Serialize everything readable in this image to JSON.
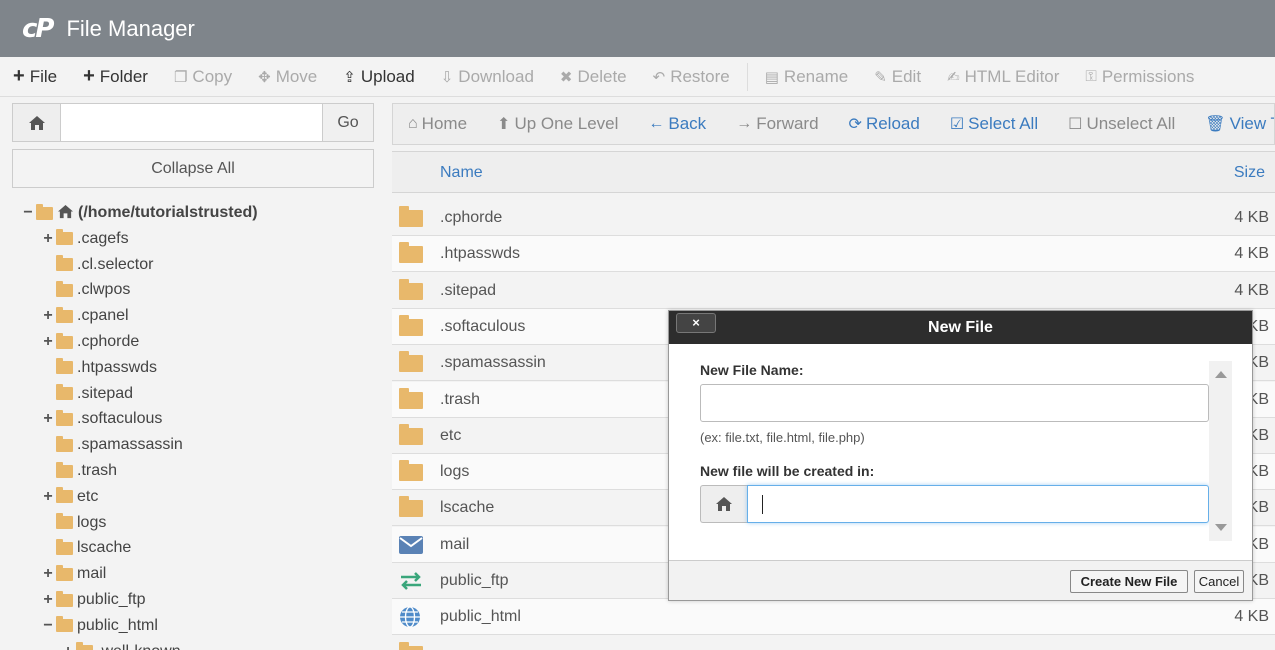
{
  "header": {
    "logo": "cP",
    "title": "File Manager"
  },
  "toolbar": [
    {
      "label": "File",
      "icon": "plus",
      "disabled": false
    },
    {
      "label": "Folder",
      "icon": "plus",
      "disabled": false
    },
    {
      "label": "Copy",
      "icon": "copy",
      "disabled": true
    },
    {
      "label": "Move",
      "icon": "move",
      "disabled": true
    },
    {
      "label": "Upload",
      "icon": "upload",
      "disabled": false
    },
    {
      "label": "Download",
      "icon": "download",
      "disabled": true
    },
    {
      "label": "Delete",
      "icon": "times",
      "disabled": true
    },
    {
      "label": "Restore",
      "icon": "undo",
      "disabled": true
    },
    {
      "label": "Rename",
      "icon": "file",
      "disabled": true
    },
    {
      "label": "Edit",
      "icon": "pencil",
      "disabled": true
    },
    {
      "label": "HTML Editor",
      "icon": "edit",
      "disabled": true
    },
    {
      "label": "Permissions",
      "icon": "key",
      "disabled": true
    }
  ],
  "left": {
    "search_value": "",
    "go_label": "Go",
    "collapse_label": "Collapse All",
    "tree": [
      {
        "label": "(/home/tutorialstrusted)",
        "toggle": "−",
        "level": 0,
        "root": true
      },
      {
        "label": ".cagefs",
        "toggle": "+",
        "level": 1
      },
      {
        "label": ".cl.selector",
        "toggle": "",
        "level": 1
      },
      {
        "label": ".clwpos",
        "toggle": "",
        "level": 1
      },
      {
        "label": ".cpanel",
        "toggle": "+",
        "level": 1
      },
      {
        "label": ".cphorde",
        "toggle": "+",
        "level": 1
      },
      {
        "label": ".htpasswds",
        "toggle": "",
        "level": 1
      },
      {
        "label": ".sitepad",
        "toggle": "",
        "level": 1
      },
      {
        "label": ".softaculous",
        "toggle": "+",
        "level": 1
      },
      {
        "label": ".spamassassin",
        "toggle": "",
        "level": 1
      },
      {
        "label": ".trash",
        "toggle": "",
        "level": 1
      },
      {
        "label": "etc",
        "toggle": "+",
        "level": 1
      },
      {
        "label": "logs",
        "toggle": "",
        "level": 1
      },
      {
        "label": "lscache",
        "toggle": "",
        "level": 1
      },
      {
        "label": "mail",
        "toggle": "+",
        "level": 1
      },
      {
        "label": "public_ftp",
        "toggle": "+",
        "level": 1
      },
      {
        "label": "public_html",
        "toggle": "−",
        "level": 1,
        "open": true
      },
      {
        "label": ".well-known",
        "toggle": "+",
        "level": 2
      }
    ]
  },
  "nav": [
    {
      "label": "Home",
      "icon": "home",
      "style": "gray"
    },
    {
      "label": "Up One Level",
      "icon": "up",
      "style": "gray"
    },
    {
      "label": "Back",
      "icon": "left",
      "style": "blue"
    },
    {
      "label": "Forward",
      "icon": "right",
      "style": "gray"
    },
    {
      "label": "Reload",
      "icon": "refresh",
      "style": "blue"
    },
    {
      "label": "Select All",
      "icon": "check-square",
      "style": "blue"
    },
    {
      "label": "Unselect All",
      "icon": "square",
      "style": "gray"
    },
    {
      "label": "View T",
      "icon": "trash",
      "style": "blue"
    }
  ],
  "file_header": {
    "name": "Name",
    "size": "Size"
  },
  "files": [
    {
      "name": ".cphorde",
      "size": "4 KB",
      "icon": "folder"
    },
    {
      "name": ".htpasswds",
      "size": "4 KB",
      "icon": "folder"
    },
    {
      "name": ".sitepad",
      "size": "4 KB",
      "icon": "folder"
    },
    {
      "name": ".softaculous",
      "size": "KB",
      "icon": "folder"
    },
    {
      "name": ".spamassassin",
      "size": "KB",
      "icon": "folder"
    },
    {
      "name": ".trash",
      "size": "KB",
      "icon": "folder"
    },
    {
      "name": "etc",
      "size": "KB",
      "icon": "folder"
    },
    {
      "name": "logs",
      "size": "KB",
      "icon": "folder"
    },
    {
      "name": "lscache",
      "size": "KB",
      "icon": "folder"
    },
    {
      "name": "mail",
      "size": "KB",
      "icon": "mail"
    },
    {
      "name": "public_ftp",
      "size": "KB",
      "icon": "ftp"
    },
    {
      "name": "public_html",
      "size": "4 KB",
      "icon": "globe"
    },
    {
      "name": "",
      "size": "",
      "icon": "folder"
    }
  ],
  "modal": {
    "title": "New File",
    "close_label": "×",
    "name_label": "New File Name:",
    "name_value": "",
    "hint": "(ex: file.txt, file.html, file.php)",
    "path_label": "New file will be created in:",
    "path_value": "",
    "create_label": "Create New File",
    "cancel_label": "Cancel"
  },
  "colors": {
    "header_bg": "#7f858b",
    "link_blue": "#3b7bbf",
    "folder": "#e8b86b",
    "modal_title_bg": "#2d2d2d"
  }
}
